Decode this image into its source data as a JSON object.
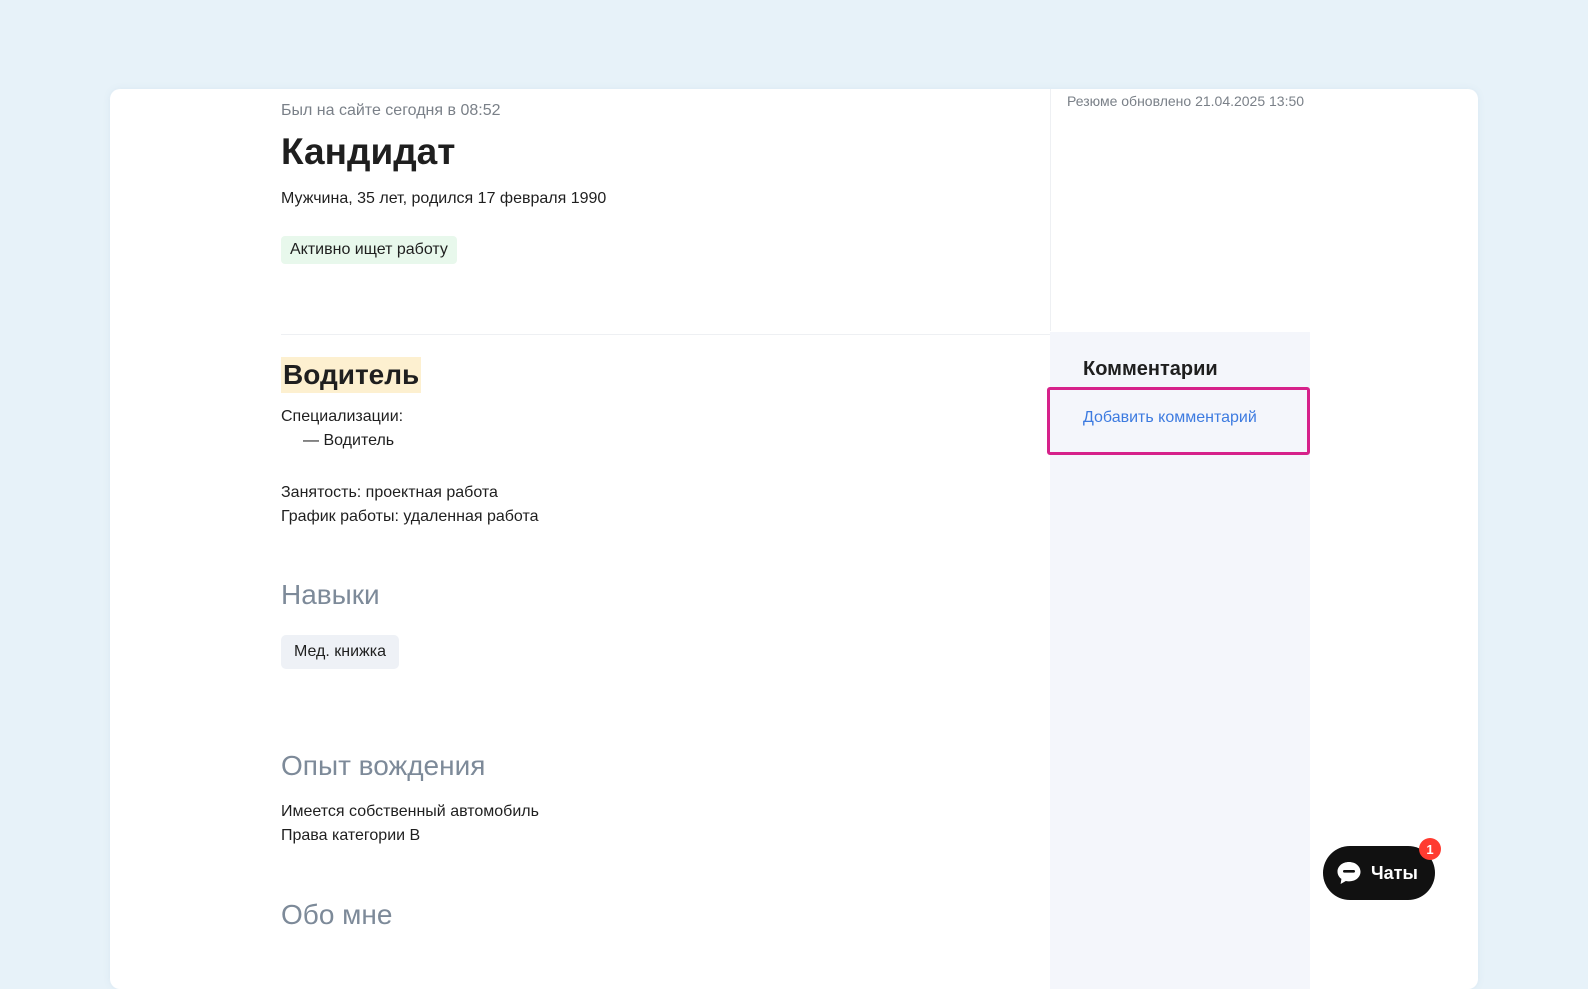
{
  "profile": {
    "last_seen": "Был на сайте сегодня в 08:52",
    "name": "Кандидат",
    "demographics": "Мужчина, 35 лет, родился 17 февраля 1990",
    "status": "Активно ищет работу",
    "resume_updated": "Резюме обновлено 21.04.2025 13:50"
  },
  "position": {
    "title": "Водитель",
    "specializations_label": "Специализации:",
    "specializations": [
      "— Водитель"
    ],
    "employment": "Занятость: проектная работа",
    "schedule": "График работы: удаленная работа"
  },
  "skills": {
    "title": "Навыки",
    "items": [
      "Мед. книжка"
    ]
  },
  "driving": {
    "title": "Опыт вождения",
    "own_car": "Имеется собственный автомобиль",
    "license": "Права категории B"
  },
  "about": {
    "title": "Обо мне"
  },
  "comments": {
    "title": "Комментарии",
    "add_label": "Добавить комментарий"
  },
  "chats": {
    "label": "Чаты",
    "unread_count": "1",
    "icon": "chat-bubble-icon"
  },
  "colors": {
    "background": "#e7f2f9",
    "status_badge_bg": "#e8f8ec",
    "highlight": "#fdf0d0",
    "link": "#3d7be0",
    "annotation_box": "#d6218a",
    "sidebar_bg": "#f4f6fb"
  }
}
